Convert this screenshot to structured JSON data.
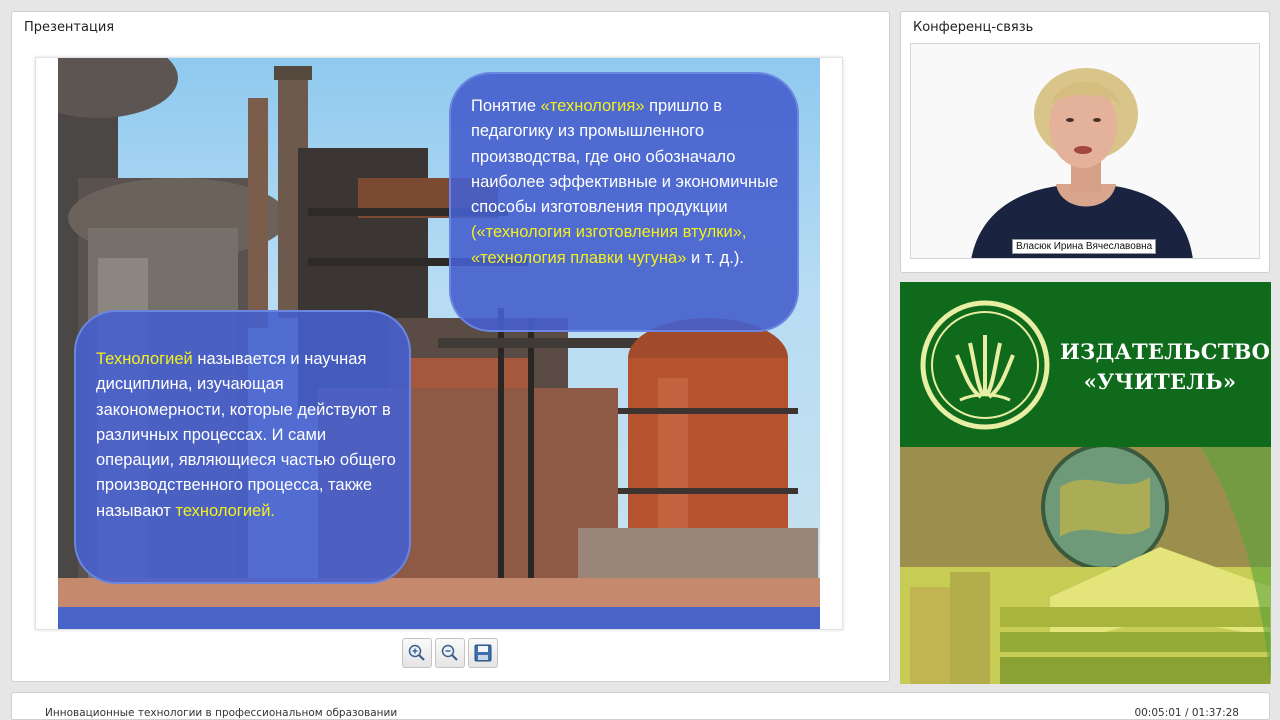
{
  "presentation": {
    "title": "Презентация",
    "slide": {
      "bubble_top": {
        "t1": "Понятие ",
        "t2": "«технология»",
        "t3": " пришло в педагогику из промышленного производства, где оно обозначало наиболее эффективные и экономичные способы изготовления продукции ",
        "t4": "(«технология изготовления втулки», «технология плавки чугуна»",
        "t5": " и т. д.)."
      },
      "bubble_bottom": {
        "t1": "Технологией",
        "t2": " называется и научная дисциплина, изучающая закономерности, которые действуют в различных процессах. И сами операции, являющиеся частью общего производственного процесса, также называют ",
        "t3": "технологией."
      }
    },
    "toolbar": {
      "zoom_in_icon": "magnifier-plus",
      "zoom_out_icon": "magnifier-minus",
      "save_icon": "floppy-disk"
    }
  },
  "conference": {
    "title": "Конференц-связь",
    "speaker_name": "Власюк Ирина Вячеславовна"
  },
  "publisher": {
    "name_line1": "ИЗДАТЕЛЬСТВО",
    "name_line2": "«УЧИТЕЛЬ»"
  },
  "status": {
    "lecture_title": "Инновационные технологии в профессиональном образовании",
    "time_current": "00:05:01",
    "time_total": "01:37:28",
    "time_separator": " / "
  },
  "colors": {
    "bubble_blue": "#465fcd",
    "highlight_yellow": "#f3f01e",
    "publisher_green": "#0f6a1c"
  }
}
